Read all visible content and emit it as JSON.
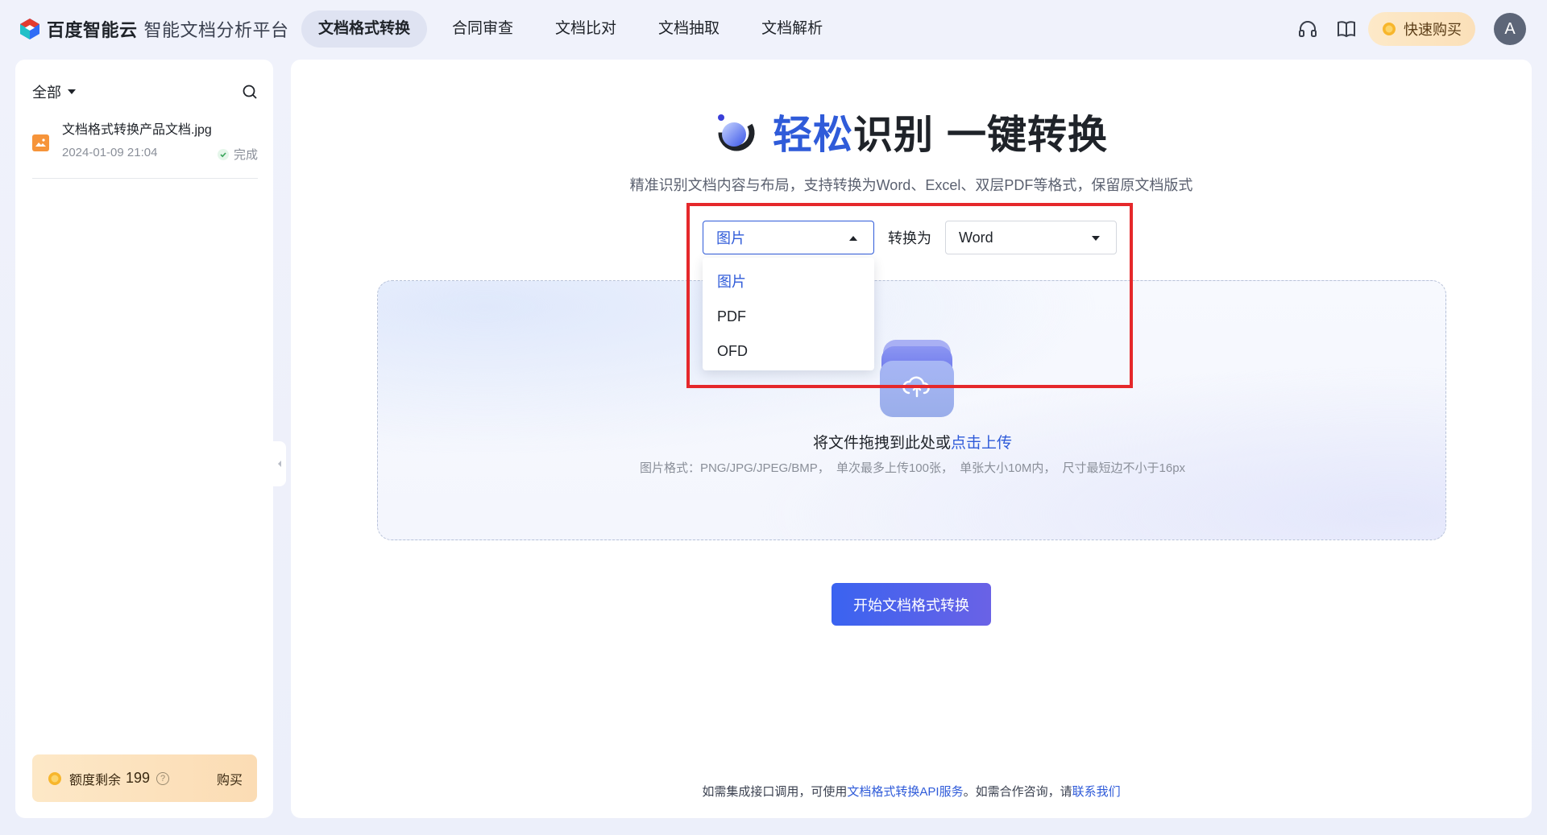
{
  "brand": {
    "name": "百度智能云",
    "product": "智能文档分析平台"
  },
  "nav": {
    "items": [
      "文档格式转换",
      "合同审查",
      "文档比对",
      "文档抽取",
      "文档解析"
    ],
    "active": "文档格式转换"
  },
  "header": {
    "buy_label": "快速购买",
    "avatar_letter": "A"
  },
  "sidebar": {
    "filter_label": "全部",
    "files": [
      {
        "name": "文档格式转换产品文档.jpg",
        "date": "2024-01-09 21:04",
        "status": "完成"
      }
    ],
    "quota": {
      "label": "额度剩余",
      "value": "199",
      "help": "?",
      "buy": "购买"
    }
  },
  "main": {
    "title_highlight": "轻松",
    "title_rest1": "识别",
    "title_rest2": "一键转换",
    "subtitle": "精准识别文档内容与布局，支持转换为Word、Excel、双层PDF等格式，保留原文档版式",
    "source_select": {
      "value": "图片",
      "options": [
        "图片",
        "PDF",
        "OFD"
      ]
    },
    "convert_to_label": "转换为",
    "target_select": {
      "value": "Word"
    },
    "upload": {
      "text": "将文件拖拽到此处或",
      "link": "点击上传",
      "hint": "图片格式：PNG/JPG/JPEG/BMP， 单次最多上传100张， 单张大小10M内， 尺寸最短边不小于16px"
    },
    "start_button": "开始文档格式转换",
    "footer": {
      "part1": "如需集成接口调用，可使用",
      "link1": "文档格式转换API服务",
      "part2": "。如需合作咨询，请",
      "link2": "联系我们"
    }
  },
  "colors": {
    "accent": "#2f5bd9",
    "highlight_box": "#e5282b",
    "quota_bg": "#fbe0b9"
  }
}
